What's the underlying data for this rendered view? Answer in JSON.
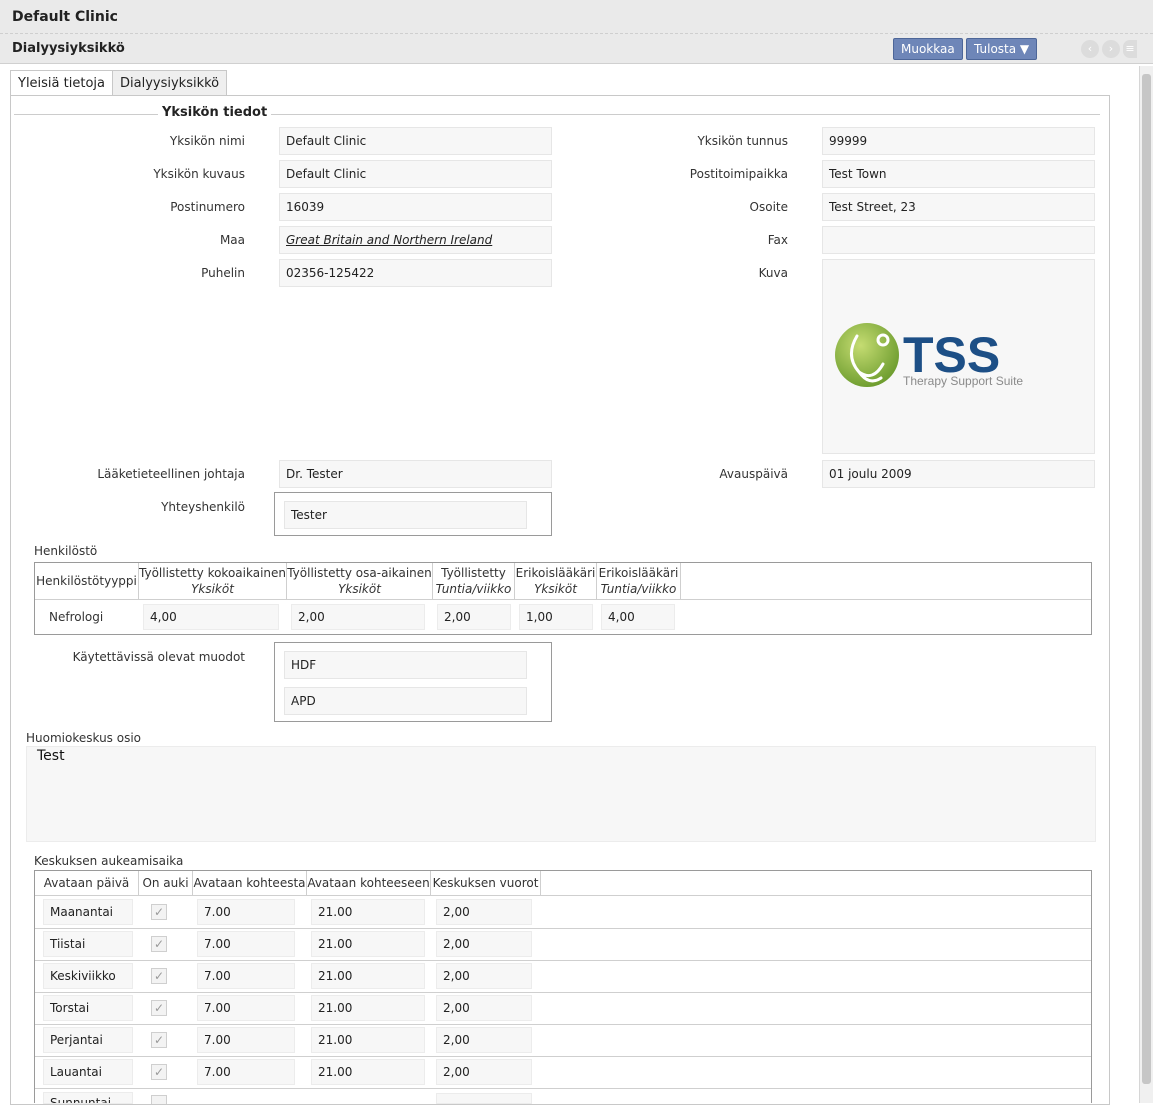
{
  "window": {
    "title": "Default Clinic"
  },
  "toolbar": {
    "title": "Dialyysiyksikkö",
    "edit_label": "Muokkaa",
    "print_label": "Tulosta ▼",
    "prev_glyph": "‹",
    "next_glyph": "›",
    "menu_glyph": "≡"
  },
  "tabs": [
    {
      "label": "Yleisiä tietoja",
      "active": true
    },
    {
      "label": "Dialyysiyksikkö",
      "active": false
    }
  ],
  "unit_info": {
    "section_title": "Yksikön tiedot",
    "name_label": "Yksikön nimi",
    "name_value": "Default Clinic",
    "code_label": "Yksikön tunnus",
    "code_value": "99999",
    "desc_label": "Yksikön kuvaus",
    "desc_value": "Default Clinic",
    "city_label": "Postitoimipaikka",
    "city_value": "Test Town",
    "postal_label": "Postinumero",
    "postal_value": "16039",
    "address_label": "Osoite",
    "address_value": "Test Street, 23",
    "country_label": "Maa",
    "country_value": "Great Britain and Northern Ireland",
    "fax_label": "Fax",
    "fax_value": "",
    "phone_label": "Puhelin",
    "phone_value": "02356-125422",
    "image_label": "Kuva",
    "logo_text": "TSS",
    "logo_subtext": "Therapy Support Suite",
    "director_label": "Lääketieteellinen johtaja",
    "director_value": "Dr. Tester",
    "opening_label": "Avauspäivä",
    "opening_value": "01 joulu 2009",
    "contact_label": "Yhteyshenkilö",
    "contact_value": "Tester"
  },
  "staff": {
    "title": "Henkilöstö",
    "headers": [
      {
        "main": "Henkilöstötyyppi",
        "sub": ""
      },
      {
        "main": "Työllistetty kokoaikainen",
        "sub": "Yksiköt"
      },
      {
        "main": "Työllistetty osa-aikainen",
        "sub": "Yksiköt"
      },
      {
        "main": "Työllistetty",
        "sub": "Tuntia/viikko"
      },
      {
        "main": "Erikoislääkäri",
        "sub": "Yksiköt"
      },
      {
        "main": "Erikoislääkäri",
        "sub": "Tuntia/viikko"
      }
    ],
    "rows": [
      [
        "Nefrologi",
        "4,00",
        "2,00",
        "2,00",
        "1,00",
        "4,00"
      ]
    ]
  },
  "modalities": {
    "label": "Käytettävissä olevat muodot",
    "items": [
      "HDF",
      "APD"
    ]
  },
  "notes": {
    "label": "Huomiokeskus osio",
    "value": "Test"
  },
  "opening_hours": {
    "title": "Keskuksen aukeamisaika",
    "headers": [
      "Avataan päivä",
      "On auki",
      "Avataan kohteesta",
      "Avataan kohteeseen",
      "Keskuksen vuorot"
    ],
    "check_glyph": "✓",
    "rows": [
      {
        "day": "Maanantai",
        "open": true,
        "from": "7.00",
        "to": "21.00",
        "shifts": "2,00"
      },
      {
        "day": "Tiistai",
        "open": true,
        "from": "7.00",
        "to": "21.00",
        "shifts": "2,00"
      },
      {
        "day": "Keskiviikko",
        "open": true,
        "from": "7.00",
        "to": "21.00",
        "shifts": "2,00"
      },
      {
        "day": "Torstai",
        "open": true,
        "from": "7.00",
        "to": "21.00",
        "shifts": "2,00"
      },
      {
        "day": "Perjantai",
        "open": true,
        "from": "7.00",
        "to": "21.00",
        "shifts": "2,00"
      },
      {
        "day": "Lauantai",
        "open": true,
        "from": "7.00",
        "to": "21.00",
        "shifts": "2,00"
      },
      {
        "day": "Sunnuntai",
        "open": false,
        "from": "",
        "to": "",
        "shifts": ""
      }
    ]
  }
}
